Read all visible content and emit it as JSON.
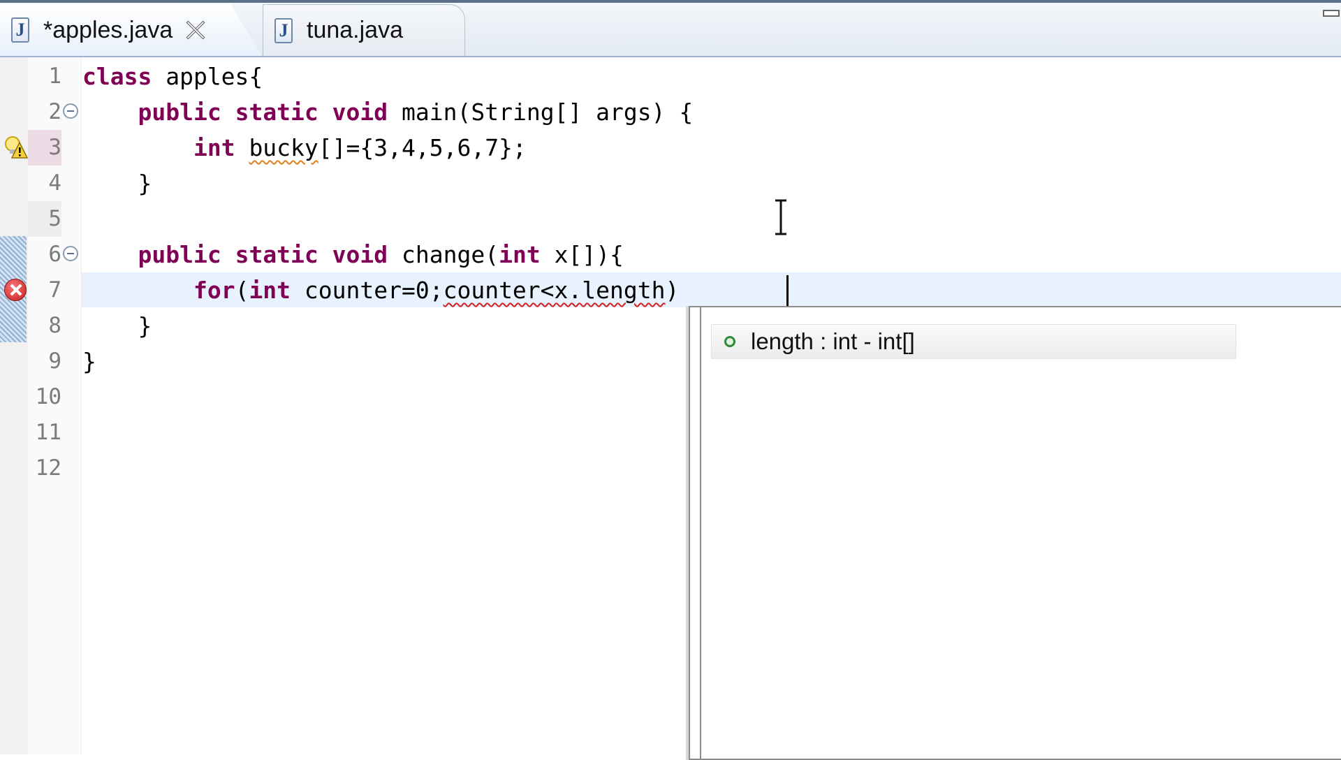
{
  "tabs": [
    {
      "label": "*apples.java",
      "active": true,
      "icon": "java-file-icon"
    },
    {
      "label": "tuna.java",
      "active": false,
      "icon": "java-file-icon"
    }
  ],
  "editor": {
    "line_numbers": [
      "1",
      "2",
      "3",
      "4",
      "5",
      "6",
      "7",
      "8",
      "9",
      "10",
      "11",
      "12"
    ],
    "lines": {
      "l1": {
        "kw": "class",
        "rest": " apples{"
      },
      "l2": {
        "indent": "    ",
        "kw1": "public",
        "kw2": "static",
        "kw3": "void",
        "rest": " main(String[] args) {"
      },
      "l3": {
        "indent": "        ",
        "kw": "int",
        "sp": " ",
        "ident": "bucky",
        "rest": "[]={3,4,5,6,7};"
      },
      "l4": {
        "text": "    }"
      },
      "l6": {
        "indent": "    ",
        "kw1": "public",
        "kw2": "static",
        "kw3": "void",
        "mid": " change(",
        "kw4": "int",
        "rest": " x[]){"
      },
      "l7": {
        "indent": "        ",
        "kw1": "for",
        "p": "(",
        "kw2": "int",
        "mid": " counter=0;",
        "err": "counter<x.length",
        "rest": ")"
      },
      "l8": {
        "text": "    }"
      },
      "l9": {
        "text": "}"
      }
    },
    "markers": {
      "warning_line": "3",
      "error_line": "7"
    },
    "colors": {
      "keyword": "#7f0055",
      "current_line": "#e8f2fe",
      "warning_underline": "#e0801a",
      "error_underline": "#d02020"
    }
  },
  "completion": {
    "items": [
      {
        "label": "length : int - int[]",
        "icon": "field-icon"
      }
    ]
  }
}
